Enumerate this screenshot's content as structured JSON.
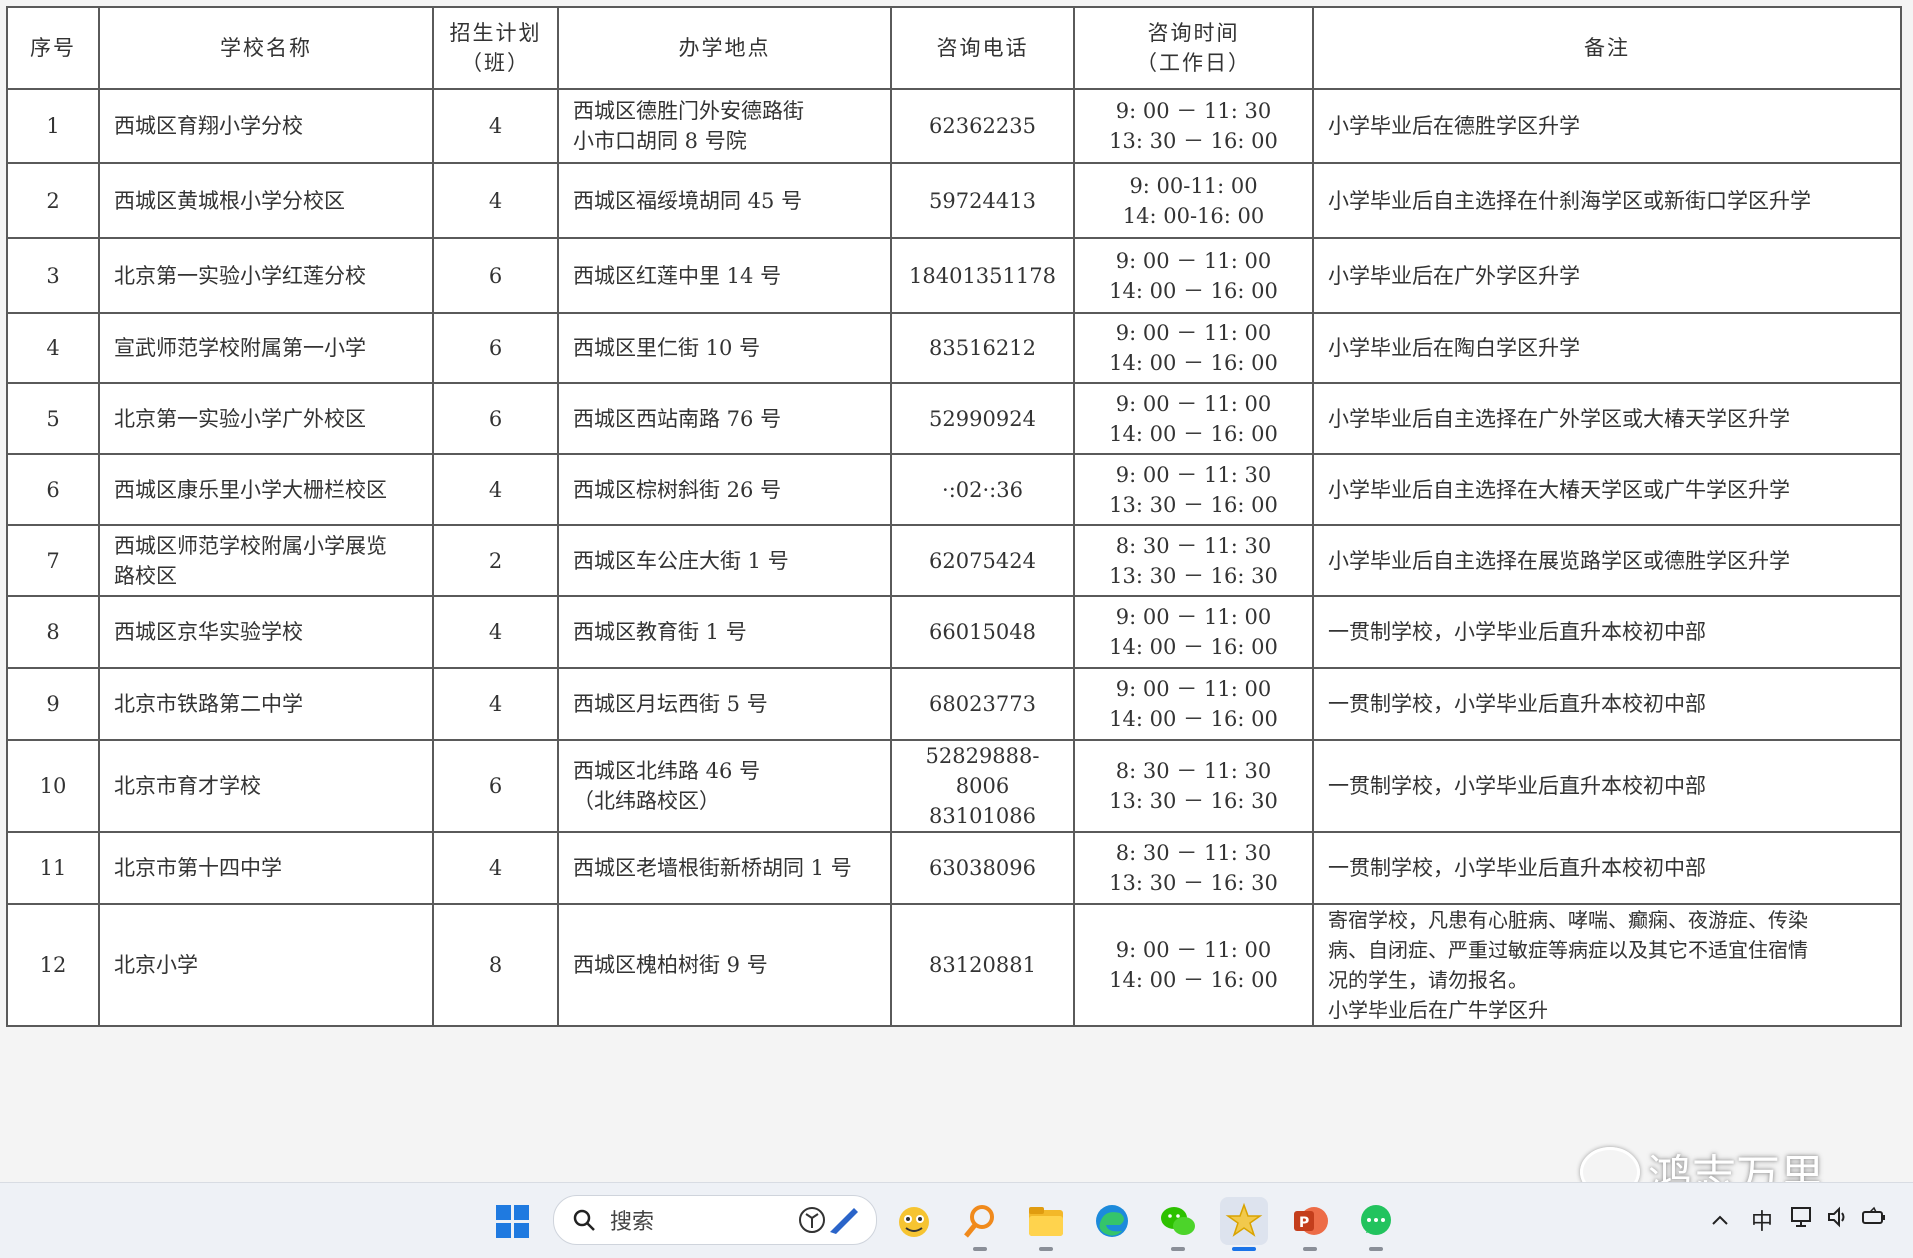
{
  "table": {
    "headers": {
      "no": "序号",
      "name": "学校名称",
      "plan": [
        "招生计划",
        "（班）"
      ],
      "address": "办学地点",
      "phone": "咨询电话",
      "time": [
        "咨询时间",
        "（工作日）"
      ],
      "remark": "备注"
    },
    "rows": [
      {
        "no": "1",
        "name": [
          "西城区育翔小学分校"
        ],
        "plan": "4",
        "address": [
          "西城区德胜门外安德路街",
          "小市口胡同 8 号院"
        ],
        "phone": [
          "62362235"
        ],
        "time": [
          "9: 00 － 11: 30",
          "13: 30 － 16: 00"
        ],
        "remark": [
          "小学毕业后在德胜学区升学"
        ]
      },
      {
        "no": "2",
        "name": [
          "西城区黄城根小学分校区"
        ],
        "plan": "4",
        "address": [
          "西城区福绥境胡同 45 号"
        ],
        "phone": [
          "59724413"
        ],
        "time": [
          "9: 00-11: 00",
          "14: 00-16: 00"
        ],
        "remark": [
          "小学毕业后自主选择在什刹海学区或新街口学区升学"
        ]
      },
      {
        "no": "3",
        "name": [
          "北京第一实验小学红莲分校"
        ],
        "plan": "6",
        "address": [
          "西城区红莲中里 14 号"
        ],
        "phone": [
          "18401351178"
        ],
        "time": [
          "9: 00 － 11: 00",
          "14: 00 － 16: 00"
        ],
        "remark": [
          "小学毕业后在广外学区升学"
        ]
      },
      {
        "no": "4",
        "name": [
          "宣武师范学校附属第一小学"
        ],
        "plan": "6",
        "address": [
          "西城区里仁街 10 号"
        ],
        "phone": [
          "83516212"
        ],
        "time": [
          "9: 00 － 11: 00",
          "14: 00 － 16: 00"
        ],
        "remark": [
          "小学毕业后在陶白学区升学"
        ]
      },
      {
        "no": "5",
        "name": [
          "北京第一实验小学广外校区"
        ],
        "plan": "6",
        "address": [
          "西城区西站南路 76 号"
        ],
        "phone": [
          "52990924"
        ],
        "time": [
          "9: 00 － 11: 00",
          "14: 00 － 16: 00"
        ],
        "remark": [
          "小学毕业后自主选择在广外学区或大椿天学区升学"
        ]
      },
      {
        "no": "6",
        "name": [
          "西城区康乐里小学大栅栏校区"
        ],
        "plan": "4",
        "address": [
          "西城区棕树斜街 26 号"
        ],
        "phone": [
          "·:02·:36"
        ],
        "time": [
          "9: 00 － 11: 30",
          "13: 30 － 16: 00"
        ],
        "remark": [
          "小学毕业后自主选择在大椿天学区或广牛学区升学"
        ]
      },
      {
        "no": "7",
        "name": [
          "西城区师范学校附属小学展览",
          "路校区"
        ],
        "plan": "2",
        "address": [
          "西城区车公庄大街 1 号"
        ],
        "phone": [
          "62075424"
        ],
        "time": [
          "8: 30 － 11: 30",
          "13: 30 － 16: 30"
        ],
        "remark": [
          "小学毕业后自主选择在展览路学区或德胜学区升学"
        ]
      },
      {
        "no": "8",
        "name": [
          "西城区京华实验学校"
        ],
        "plan": "4",
        "address": [
          "西城区教育街 1 号"
        ],
        "phone": [
          "66015048"
        ],
        "time": [
          "9: 00 － 11: 00",
          "14: 00 － 16: 00"
        ],
        "remark": [
          "一贯制学校，小学毕业后直升本校初中部"
        ]
      },
      {
        "no": "9",
        "name": [
          "北京市铁路第二中学"
        ],
        "plan": "4",
        "address": [
          "西城区月坛西街 5 号"
        ],
        "phone": [
          "68023773"
        ],
        "time": [
          "9: 00 － 11: 00",
          "14: 00 － 16: 00"
        ],
        "remark": [
          "一贯制学校，小学毕业后直升本校初中部"
        ]
      },
      {
        "no": "10",
        "name": [
          "北京市育才学校"
        ],
        "plan": "6",
        "address": [
          "西城区北纬路 46 号",
          "（北纬路校区）"
        ],
        "phone": [
          "52829888-8006",
          "83101086"
        ],
        "time": [
          "8: 30 － 11: 30",
          "13: 30 － 16: 30"
        ],
        "remark": [
          "一贯制学校，小学毕业后直升本校初中部"
        ]
      },
      {
        "no": "11",
        "name": [
          "北京市第十四中学"
        ],
        "plan": "4",
        "address": [
          "西城区老墙根街新桥胡同 1 号"
        ],
        "phone": [
          "63038096"
        ],
        "time": [
          "8: 30 － 11: 30",
          "13: 30 － 16: 30"
        ],
        "remark": [
          "一贯制学校，小学毕业后直升本校初中部"
        ]
      },
      {
        "no": "12",
        "name": [
          "北京小学"
        ],
        "plan": "8",
        "address": [
          "西城区槐柏树街 9 号"
        ],
        "phone": [
          "83120881"
        ],
        "time": [
          "9: 00 － 11: 00",
          "14: 00 － 16: 00"
        ],
        "remark": [
          "寄宿学校，凡患有心脏病、哮喘、癫痫、夜游症、传染",
          "病、自闭症、严重过敏症等病症以及其它不适宜住宿情",
          "况的学生，请勿报名。",
          "小学毕业后在广牛学区升"
        ]
      }
    ]
  },
  "watermark": {
    "text": "鸿志万里"
  },
  "taskbar": {
    "search_placeholder": "搜索",
    "apps": [
      {
        "icon": "start-windows-icon"
      },
      {
        "icon": "emoji-app-icon"
      },
      {
        "icon": "magnifier-app-icon"
      },
      {
        "icon": "file-explorer-icon"
      },
      {
        "icon": "edge-browser-icon"
      },
      {
        "icon": "wechat-icon"
      },
      {
        "icon": "star-app-icon"
      },
      {
        "icon": "powerpoint-icon"
      },
      {
        "icon": "chat-bubble-app-icon"
      }
    ],
    "tray": {
      "ime": "中"
    },
    "colors": {
      "accent": "#1a73e8",
      "taskbar_bg": "#eef1f6"
    }
  }
}
